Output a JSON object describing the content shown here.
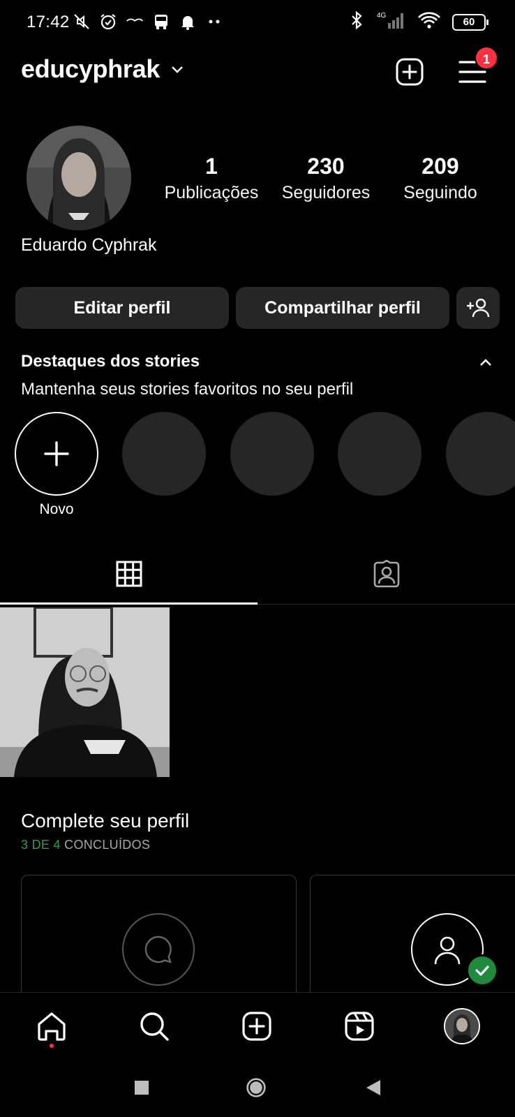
{
  "status_bar": {
    "time": "17:42",
    "left_icons": [
      "mute-icon",
      "alarm-icon",
      "ifood-icon",
      "bus-icon",
      "bell-icon",
      "more-dots-icon"
    ],
    "right_icons": [
      "bluetooth-icon",
      "signal-4g-icon",
      "wifi-icon"
    ],
    "network": "4G",
    "battery": "60"
  },
  "header": {
    "username": "educyphrak",
    "notification_count": "1"
  },
  "profile": {
    "display_name": "Eduardo Cyphrak",
    "stats": [
      {
        "value": "1",
        "label": "Publicações"
      },
      {
        "value": "230",
        "label": "Seguidores"
      },
      {
        "value": "209",
        "label": "Seguindo"
      }
    ]
  },
  "actions": {
    "edit_label": "Editar perfil",
    "share_label": "Compartilhar perfil"
  },
  "highlights": {
    "title": "Destaques dos stories",
    "subtitle": "Mantenha seus stories favoritos no seu perfil",
    "new_label": "Novo"
  },
  "tabs": [
    "grid-icon",
    "tagged-icon"
  ],
  "complete_profile": {
    "title": "Complete seu perfil",
    "progress_done": "3 DE 4",
    "progress_rest": "CONCLUÍDOS"
  },
  "bottom_nav": [
    "home-icon",
    "search-icon",
    "create-icon",
    "reels-icon",
    "profile-avatar"
  ],
  "colors": {
    "background": "#000000",
    "button": "#262626",
    "badge": "#ff3040",
    "success": "#2e9e47"
  }
}
